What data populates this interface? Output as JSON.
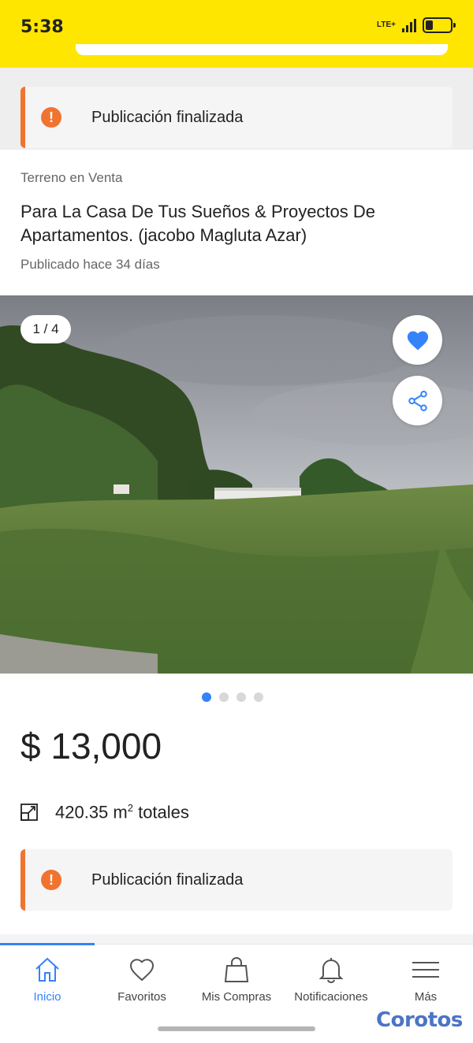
{
  "status_bar": {
    "time": "5:38",
    "network": "LTE+",
    "battery_level": 0.3
  },
  "notice_top": {
    "icon": "alert-icon",
    "glyph": "!",
    "text": "Publicación finalizada"
  },
  "listing": {
    "category": "Terreno en Venta",
    "title": "Para La Casa De Tus Sueños & Proyectos De Apartamentos. (jacobo Magluta Azar)",
    "published": "Publicado hace 34 días"
  },
  "gallery": {
    "counter": "1 / 4",
    "total": 4,
    "current": 1
  },
  "price": "$ 13,000",
  "area": {
    "value": "420.35 m",
    "sup": "2",
    "suffix": " totales"
  },
  "notice_bottom": {
    "icon": "alert-icon",
    "glyph": "!",
    "text": "Publicación finalizada"
  },
  "tabs": [
    {
      "label": "Inicio",
      "icon": "home-icon",
      "active": true
    },
    {
      "label": "Favoritos",
      "icon": "heart-icon",
      "active": false
    },
    {
      "label": "Mis Compras",
      "icon": "shopping-bag-icon",
      "active": false
    },
    {
      "label": "Notificaciones",
      "icon": "bell-icon",
      "active": false
    },
    {
      "label": "Más",
      "icon": "menu-icon",
      "active": false
    }
  ],
  "watermark": "Corotos",
  "colors": {
    "status_bar": "#ffe600",
    "accent": "#3483fa",
    "notice": "#f07430"
  }
}
